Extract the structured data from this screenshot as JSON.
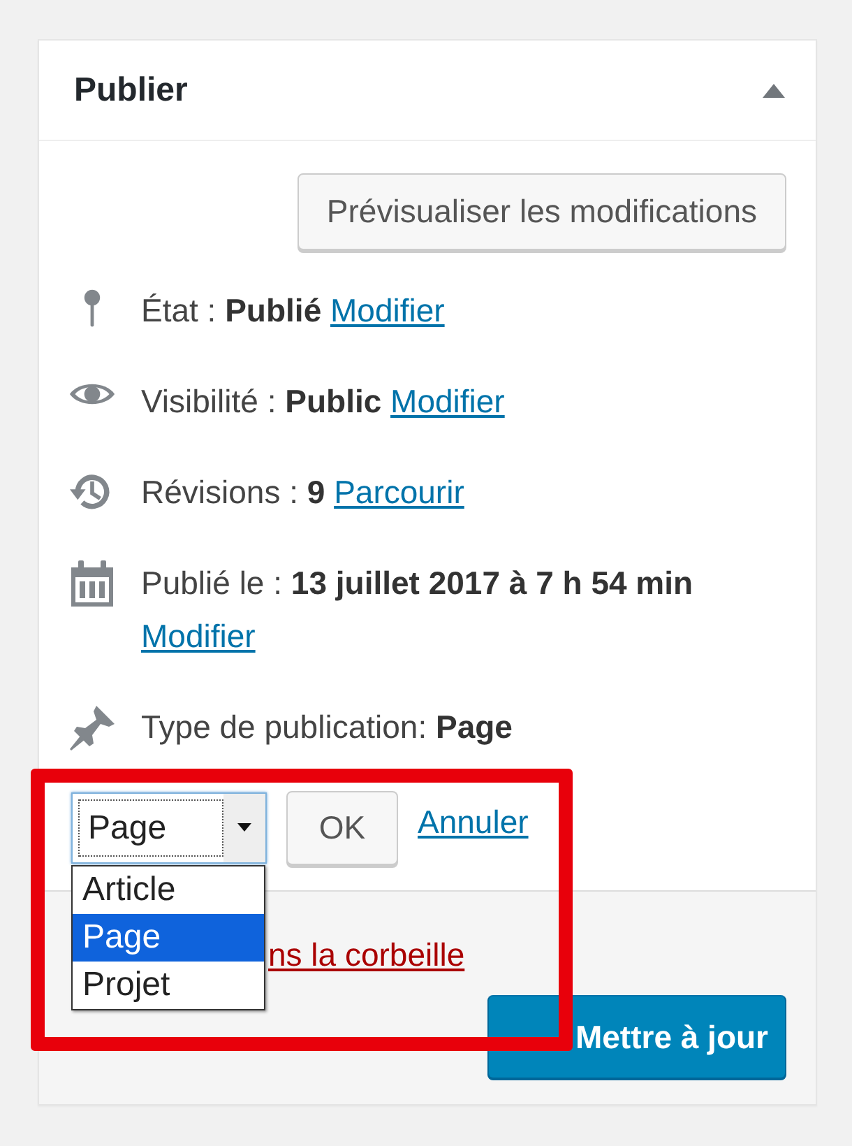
{
  "panel": {
    "title": "Publier",
    "expanded": true
  },
  "preview_button": "Prévisualiser les modifications",
  "rows": [
    {
      "kind": "pin",
      "text": "État : **Publié**",
      "link": "Modifier"
    },
    {
      "kind": "eye",
      "text": "Visibilité : **Public**",
      "link": "Modifier"
    },
    {
      "kind": "history",
      "text": "Révisions : **9**",
      "link": "Parcourir"
    },
    {
      "kind": "calendar",
      "text": "Publié le : **13 juillet 2017 à 7 h 54 min**",
      "link": "Modifier"
    },
    {
      "kind": "pushpin",
      "text": "Type de publication: **Page**"
    }
  ],
  "post_type": {
    "value": "Page",
    "ok_button": "OK",
    "cancel_link": "Annuler",
    "options": [
      {
        "label": "Article",
        "selected": false
      },
      {
        "label": "Page",
        "selected": true
      },
      {
        "label": "Projet",
        "selected": false
      }
    ]
  },
  "trash_link": "ns la corbeille",
  "update_button": "Mettre à jour",
  "annotations": [
    {
      "kind": "frame",
      "color": "#e8000b"
    }
  ]
}
